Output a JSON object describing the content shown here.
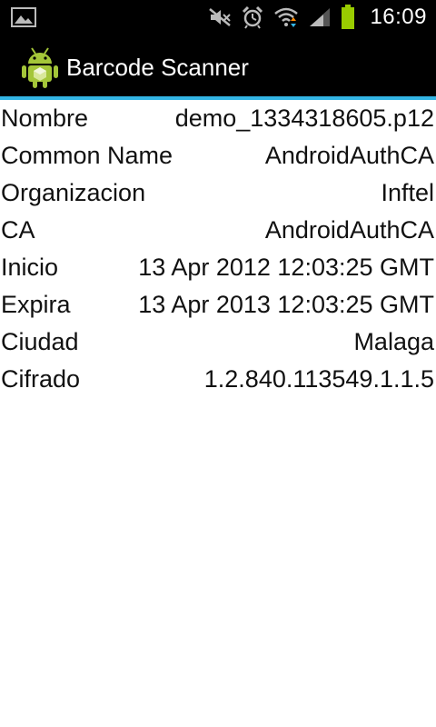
{
  "status_bar": {
    "time": "16:09",
    "icons": [
      "image-notification-icon",
      "muted-speaker-icon",
      "alarm-clock-icon",
      "wifi-icon",
      "signal-icon",
      "battery-icon"
    ]
  },
  "app_bar": {
    "title": "Barcode Scanner",
    "logo": "android-robot-icon"
  },
  "certificate": {
    "rows": [
      {
        "label": "Nombre",
        "value": "demo_1334318605.p12"
      },
      {
        "label": "Common Name",
        "value": "AndroidAuthCA"
      },
      {
        "label": "Organizacion",
        "value": "Inftel"
      },
      {
        "label": "CA",
        "value": "AndroidAuthCA"
      },
      {
        "label": "Inicio",
        "value": "13 Apr 2012 12:03:25 GMT"
      },
      {
        "label": "Expira",
        "value": "13 Apr 2013 12:03:25 GMT"
      },
      {
        "label": "Ciudad",
        "value": "Malaga"
      },
      {
        "label": "Cifrado",
        "value": "1.2.840.113549.1.1.5"
      }
    ]
  },
  "colors": {
    "status_bar_bg": "#000000",
    "app_bar_bg": "#000000",
    "accent_divider": "#33b5e5",
    "battery": "#99cc00",
    "android_green": "#a4c639"
  }
}
